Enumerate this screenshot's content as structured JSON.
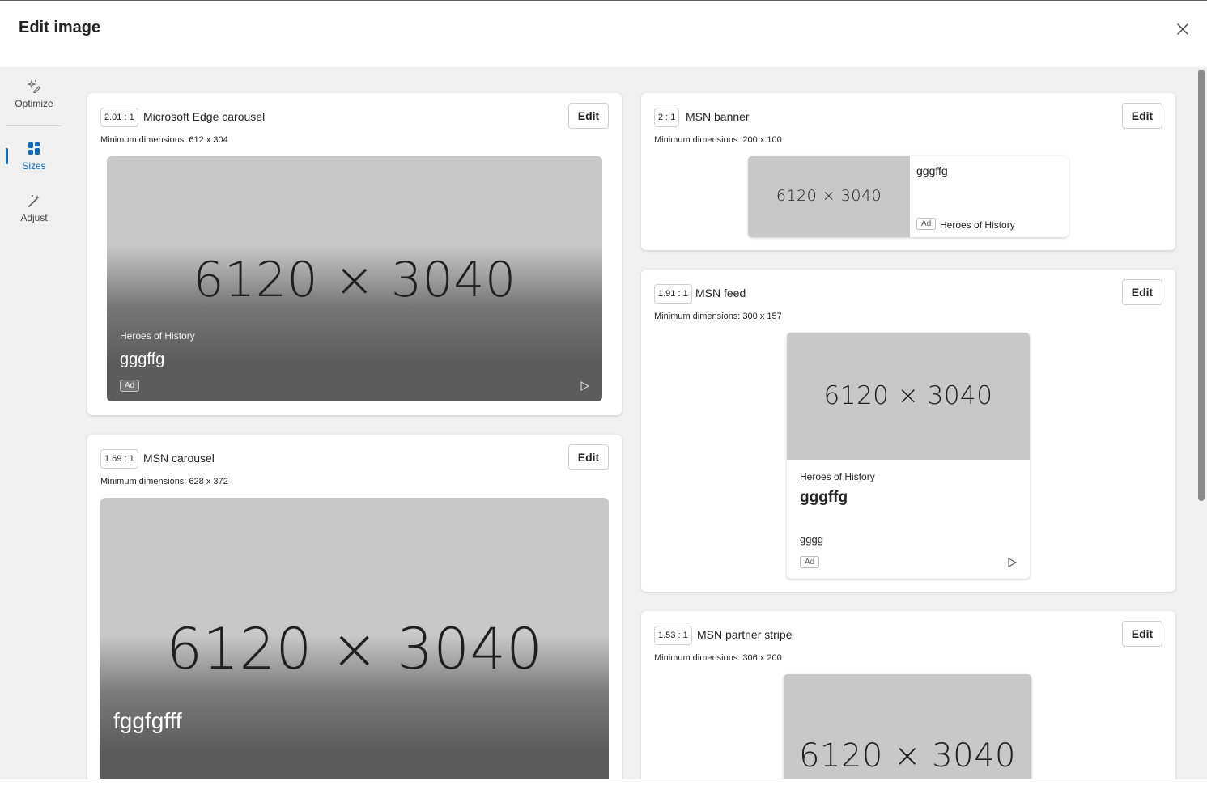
{
  "dialog": {
    "title": "Edit image"
  },
  "rail": {
    "items": [
      {
        "label": "Optimize",
        "icon": "sparkle-edit-icon"
      },
      {
        "label": "Sizes",
        "icon": "grid-icon",
        "active": true
      },
      {
        "label": "Adjust",
        "icon": "magic-wand-icon"
      }
    ]
  },
  "cards": {
    "edge_carousel": {
      "ratio": "2.01 : 1",
      "name": "Microsoft Edge carousel",
      "min_dims": "Minimum dimensions: 612 x 304",
      "edit": "Edit",
      "image_text": "6120 × 3040",
      "advertiser": "Heroes of History",
      "headline": "gggffg",
      "ad": "Ad"
    },
    "msn_carousel": {
      "ratio": "1.69 : 1",
      "name": "MSN carousel",
      "min_dims": "Minimum dimensions: 628 x 372",
      "edit": "Edit",
      "image_text": "6120 × 3040",
      "headline": "fggfgfff"
    },
    "msn_banner": {
      "ratio": "2 : 1",
      "name": "MSN banner",
      "min_dims": "Minimum dimensions: 200 x 100",
      "edit": "Edit",
      "image_text": "6120 × 3040",
      "headline": "gggffg",
      "ad": "Ad",
      "advertiser": "Heroes of History"
    },
    "msn_feed": {
      "ratio": "1.91 : 1",
      "name": "MSN feed",
      "min_dims": "Minimum dimensions: 300 x 157",
      "edit": "Edit",
      "image_text": "6120 × 3040",
      "advertiser": "Heroes of History",
      "headline": "gggffg",
      "description": "gggg",
      "ad": "Ad"
    },
    "msn_partner_stripe": {
      "ratio": "1.53 : 1",
      "name": "MSN partner stripe",
      "min_dims": "Minimum dimensions: 306 x 200",
      "edit": "Edit",
      "image_text": "6120 × 3040"
    }
  },
  "colors": {
    "accent": "#0f6cbd",
    "placeholder": "#c8c8c8",
    "panel": "#f0f0f0"
  }
}
